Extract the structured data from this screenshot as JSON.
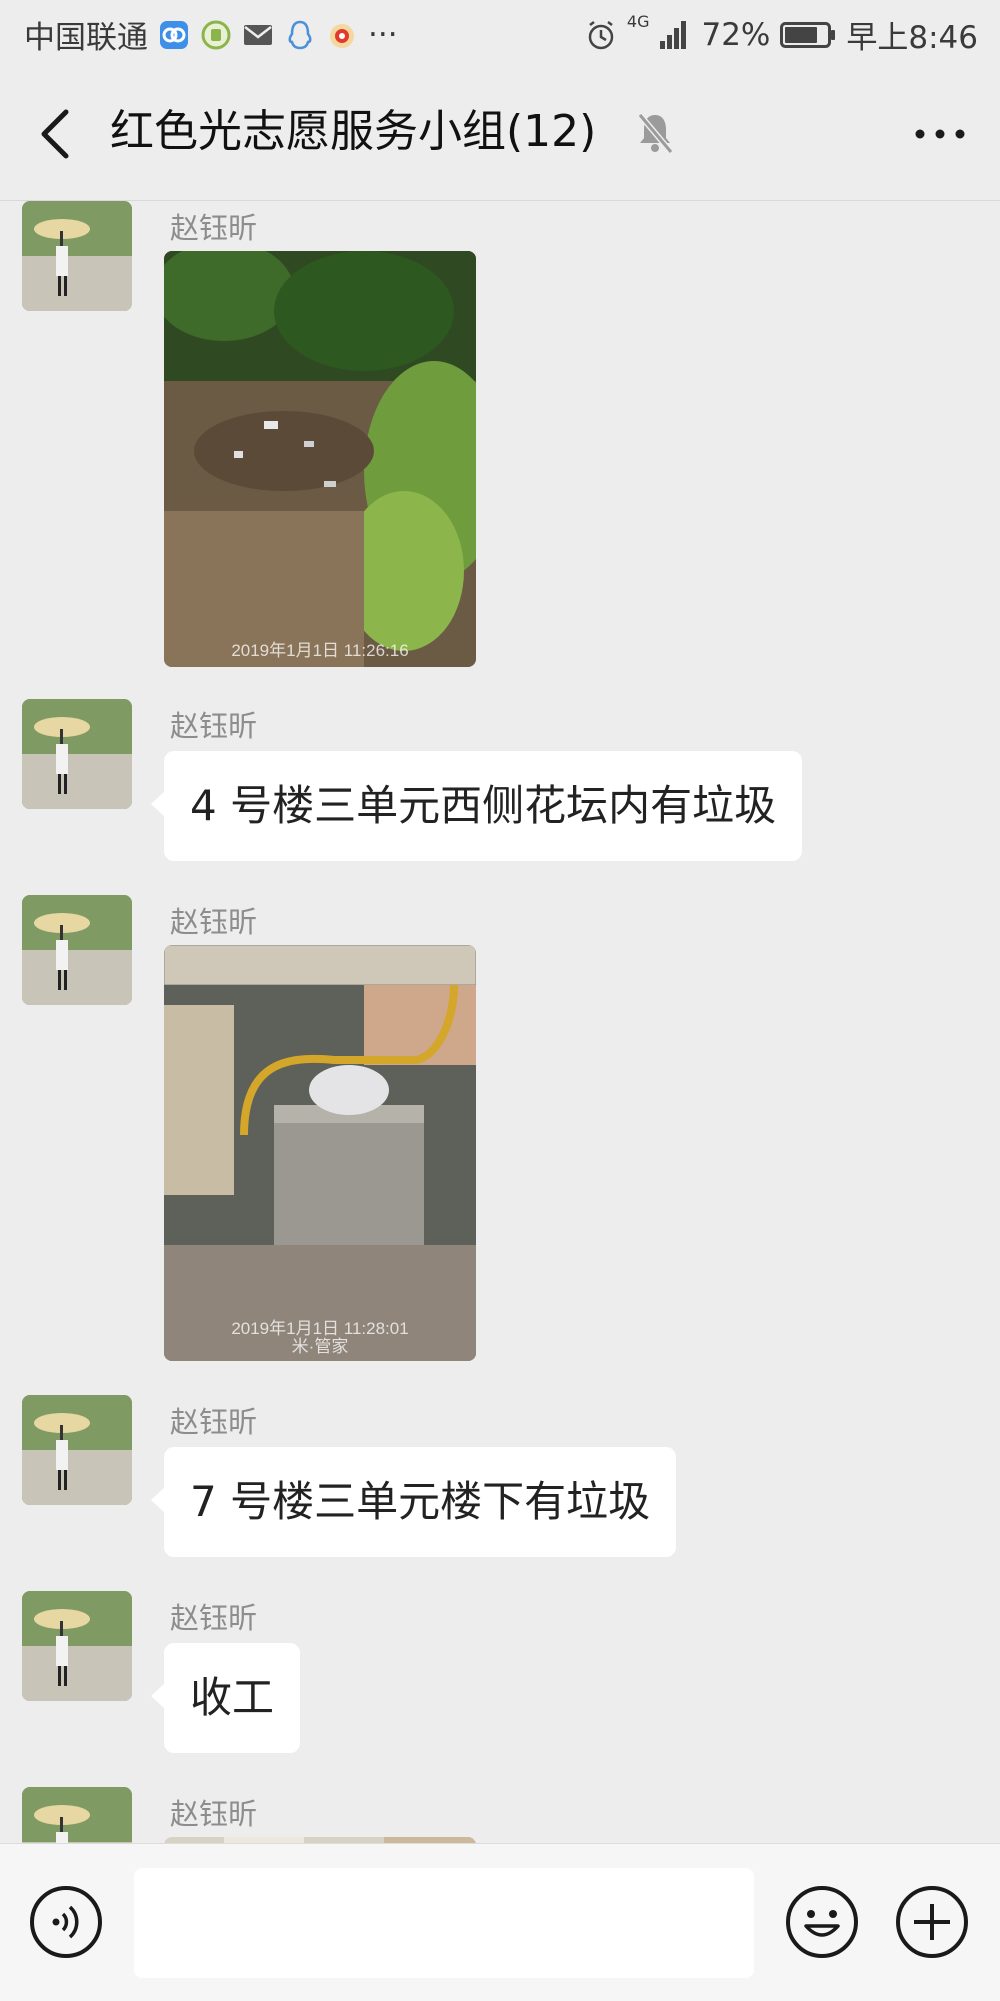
{
  "status_bar": {
    "carrier": "中国联通",
    "network": "4G",
    "battery": "72%",
    "time": "早上8:46",
    "overflow": "···"
  },
  "header": {
    "title": "红色光志愿服务小组(12)",
    "back_icon": "chevron-left-icon",
    "mute_icon": "bell-muted-icon",
    "more_icon": "more-dots-icon"
  },
  "messages": [
    {
      "sender": "赵钰昕",
      "type": "image",
      "caption": "2019年1月1日 11:26:16"
    },
    {
      "sender": "赵钰昕",
      "type": "text",
      "text": "4 号楼三单元西侧花坛内有垃圾"
    },
    {
      "sender": "赵钰昕",
      "type": "image",
      "caption": "2019年1月1日 11:28:01",
      "caption2": "米·管家"
    },
    {
      "sender": "赵钰昕",
      "type": "text",
      "text": "7 号楼三单元楼下有垃圾"
    },
    {
      "sender": "赵钰昕",
      "type": "text",
      "text": "收工"
    },
    {
      "sender": "赵钰昕",
      "type": "image"
    }
  ],
  "input_bar": {
    "placeholder": "",
    "voice_icon": "voice-icon",
    "emoji_icon": "emoji-icon",
    "plus_icon": "plus-icon"
  },
  "colors": {
    "background": "#ededed",
    "bubble": "#ffffff",
    "sender_name": "#8d8d8d"
  }
}
